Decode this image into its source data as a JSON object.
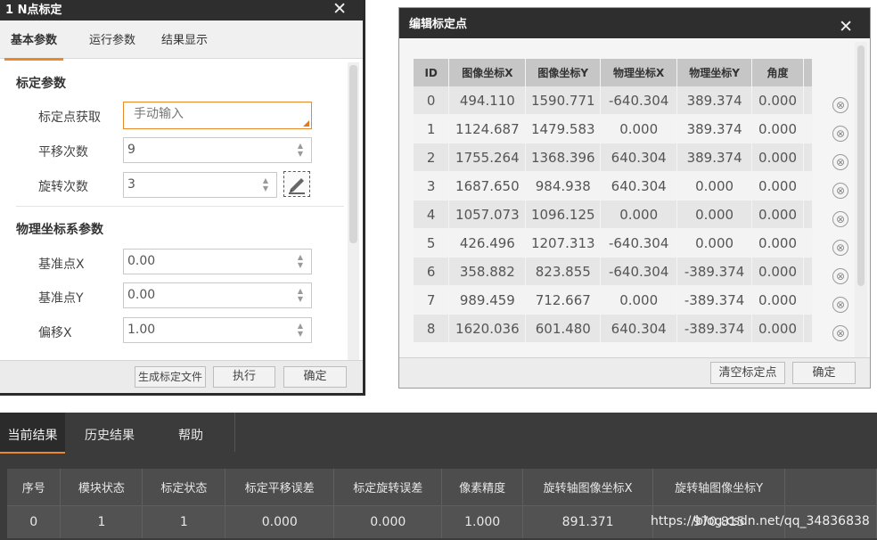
{
  "dialog_calib": {
    "title": "1 N点标定",
    "close": "✕",
    "tabs": [
      "基本参数",
      "运行参数",
      "结果显示"
    ],
    "section1": "标定参数",
    "rows1": [
      {
        "label": "标定点获取",
        "value": "手动输入"
      },
      {
        "label": "平移次数",
        "value": "9"
      },
      {
        "label": "旋转次数",
        "value": "3"
      }
    ],
    "section2": "物理坐标系参数",
    "rows2": [
      {
        "label": "基准点X",
        "value": "0.00"
      },
      {
        "label": "基准点Y",
        "value": "0.00"
      },
      {
        "label": "偏移X",
        "value": "1.00"
      }
    ],
    "buttons": {
      "generate": "生成标定文件",
      "execute": "执行",
      "ok": "确定"
    }
  },
  "dialog_points": {
    "title": "编辑标定点",
    "close": "✕",
    "columns": [
      "ID",
      "图像坐标X",
      "图像坐标Y",
      "物理坐标X",
      "物理坐标Y",
      "角度"
    ],
    "rows": [
      [
        "0",
        "494.110",
        "1590.771",
        "-640.304",
        "389.374",
        "0.000"
      ],
      [
        "1",
        "1124.687",
        "1479.583",
        "0.000",
        "389.374",
        "0.000"
      ],
      [
        "2",
        "1755.264",
        "1368.396",
        "640.304",
        "389.374",
        "0.000"
      ],
      [
        "3",
        "1687.650",
        "984.938",
        "640.304",
        "0.000",
        "0.000"
      ],
      [
        "4",
        "1057.073",
        "1096.125",
        "0.000",
        "0.000",
        "0.000"
      ],
      [
        "5",
        "426.496",
        "1207.313",
        "-640.304",
        "0.000",
        "0.000"
      ],
      [
        "6",
        "358.882",
        "823.855",
        "-640.304",
        "-389.374",
        "0.000"
      ],
      [
        "7",
        "989.459",
        "712.667",
        "0.000",
        "-389.374",
        "0.000"
      ],
      [
        "8",
        "1620.036",
        "601.480",
        "640.304",
        "-389.374",
        "0.000"
      ]
    ],
    "delete_icon": "⊗",
    "buttons": {
      "clear": "清空标定点",
      "ok": "确定"
    }
  },
  "results": {
    "tabs": [
      "当前结果",
      "历史结果",
      "帮助"
    ],
    "columns": [
      "序号",
      "模块状态",
      "标定状态",
      "标定平移误差",
      "标定旋转误差",
      "像素精度",
      "旋转轴图像坐标X",
      "旋转轴图像坐标Y",
      ""
    ],
    "row": [
      "0",
      "1",
      "1",
      "0.000",
      "0.000",
      "1.000",
      "891.371",
      "970.815",
      ""
    ]
  },
  "watermark": "https://blog.csdn.net/qq_34836838",
  "colors": {
    "accent": "#e88a2c",
    "titlebar": "#2e2e2e",
    "results_bg": "#3b3b3b"
  }
}
